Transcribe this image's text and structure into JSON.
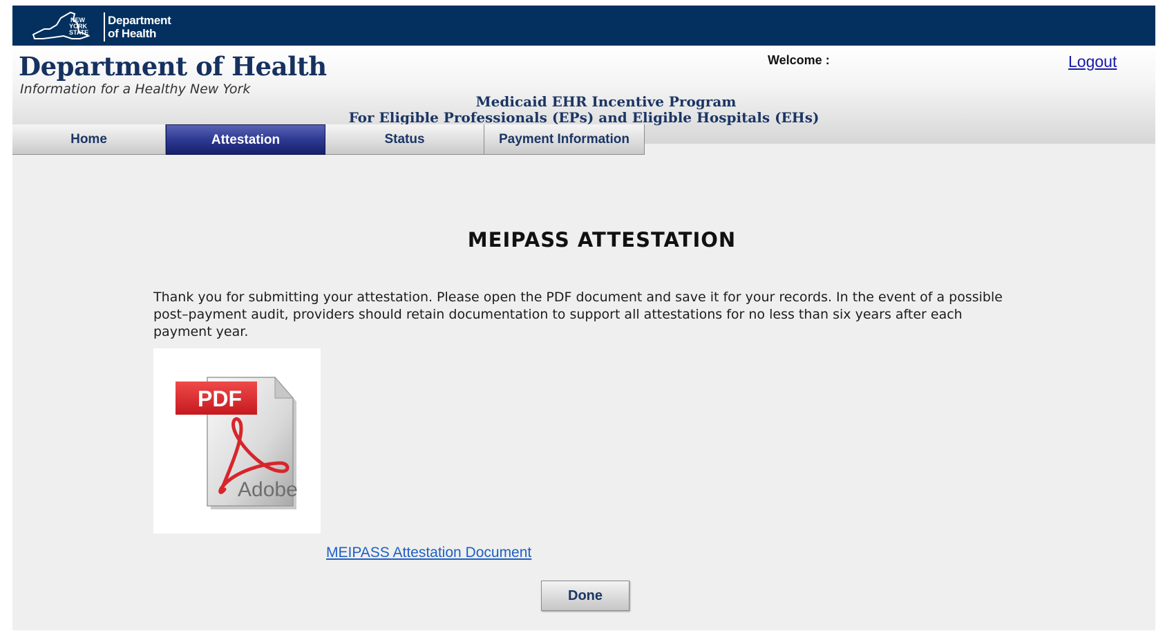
{
  "nys_logo": {
    "line1": "Department",
    "line2": "of Health",
    "state_label": "NEW YORK STATE"
  },
  "header": {
    "title": "Department of Health",
    "tagline": "Information for a Healthy New York",
    "welcome": "Welcome :",
    "logout": "Logout",
    "program_line1": "Medicaid EHR Incentive Program",
    "program_line2": "For Eligible Professionals (EPs) and Eligible Hospitals (EHs)"
  },
  "tabs": [
    {
      "label": "Home",
      "active": false
    },
    {
      "label": "Attestation",
      "active": true
    },
    {
      "label": "Status",
      "active": false
    },
    {
      "label": "Payment Information",
      "active": false
    }
  ],
  "main": {
    "title": "MEIPASS ATTESTATION",
    "message": "Thank you for submitting your attestation. Please open the PDF document and save it for your records. In the event of a possible post–payment audit, providers should retain documentation to support all attestations for no less than six years after each payment year.",
    "pdf_icon_label": "PDF",
    "pdf_icon_brand": "Adobe",
    "document_link": "MEIPASS Attestation Document",
    "done_button": "Done"
  },
  "colors": {
    "top_bar": "#03305f",
    "title_blue": "#16315f",
    "active_tab": "#2d3a93",
    "link": "#1f5fc4",
    "pdf_red": "#e0262c"
  }
}
